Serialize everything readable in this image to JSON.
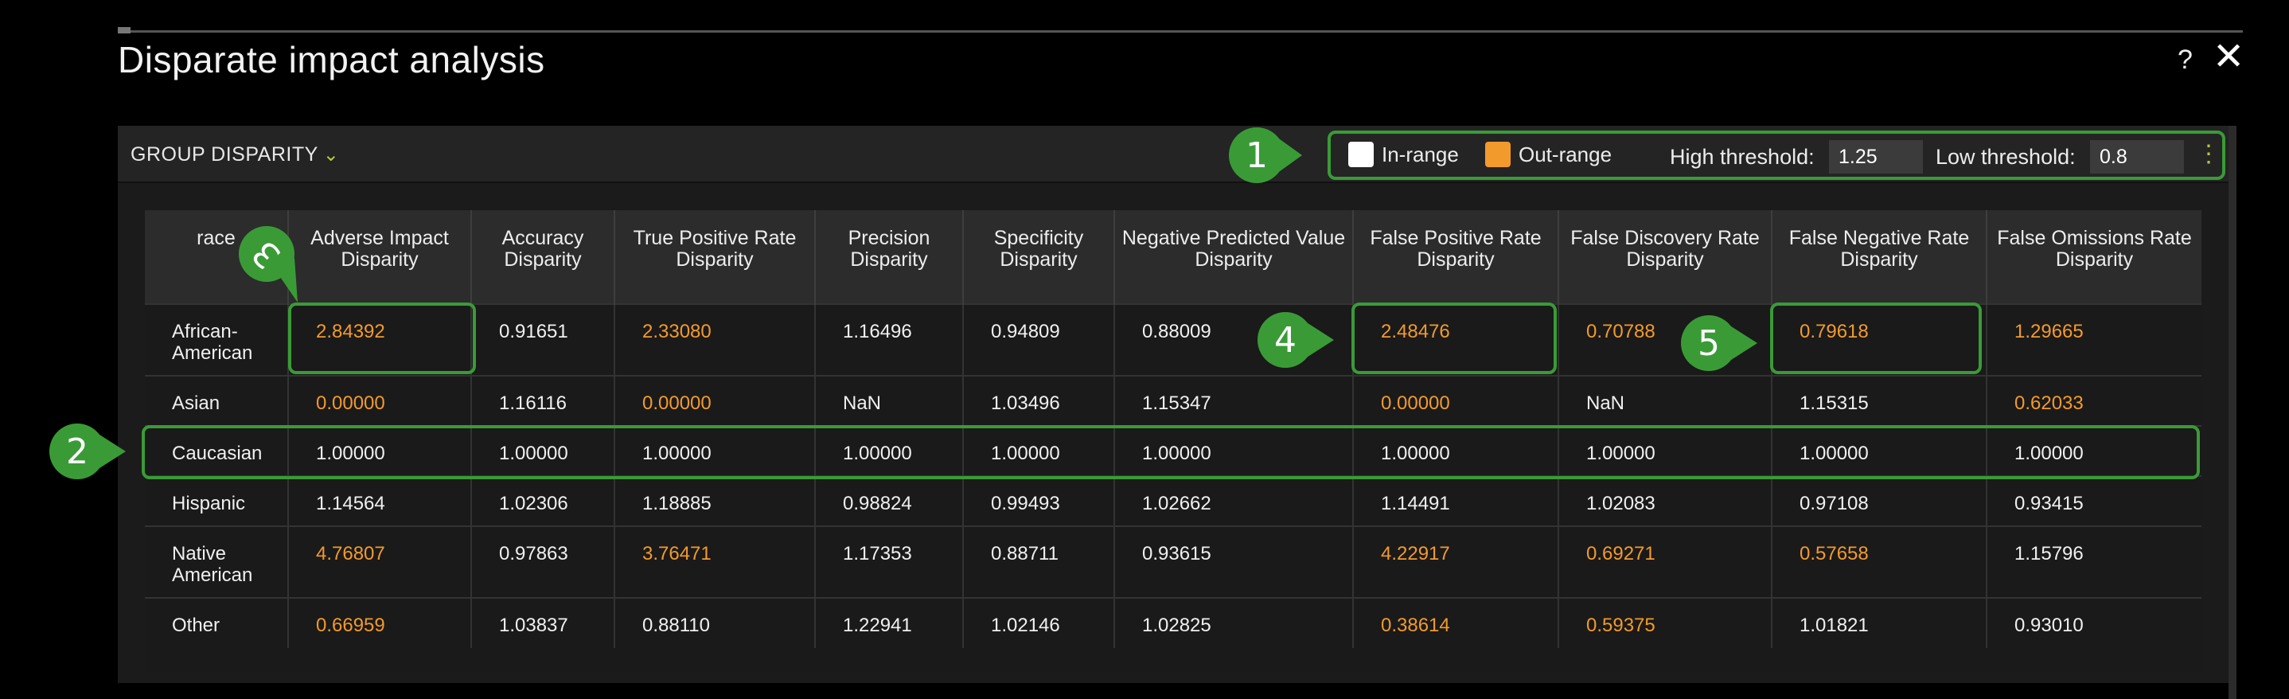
{
  "dialog": {
    "title": "Disparate impact analysis",
    "help_label": "?",
    "close_label": "✕"
  },
  "panel": {
    "section_title": "GROUP DISPARITY",
    "chevron": "⌄",
    "legend": {
      "in_range_label": "In-range",
      "out_range_label": "Out-range",
      "in_range_color": "#ffffff",
      "out_range_color": "#f39a2c"
    },
    "high_threshold_label": "High threshold:",
    "high_threshold_value": "1.25",
    "low_threshold_label": "Low threshold:",
    "low_threshold_value": "0.8",
    "menu_icon": "⋮"
  },
  "table": {
    "columns": [
      "race",
      "Adverse Impact Disparity",
      "Accuracy Disparity",
      "True Positive Rate Disparity",
      "Precision Disparity",
      "Specificity Disparity",
      "Negative Predicted Value Disparity",
      "False Positive Rate Disparity",
      "False Discovery Rate Disparity",
      "False Negative Rate Disparity",
      "False Omissions Rate Disparity"
    ],
    "rows": [
      {
        "label": "African-American",
        "cells": [
          "2.84392",
          "0.91651",
          "2.33080",
          "1.16496",
          "0.94809",
          "0.88009",
          "2.48476",
          "0.70788",
          "0.79618",
          "1.29665"
        ]
      },
      {
        "label": "Asian",
        "cells": [
          "0.00000",
          "1.16116",
          "0.00000",
          "NaN",
          "1.03496",
          "1.15347",
          "0.00000",
          "NaN",
          "1.15315",
          "0.62033"
        ]
      },
      {
        "label": "Caucasian",
        "cells": [
          "1.00000",
          "1.00000",
          "1.00000",
          "1.00000",
          "1.00000",
          "1.00000",
          "1.00000",
          "1.00000",
          "1.00000",
          "1.00000"
        ]
      },
      {
        "label": "Hispanic",
        "cells": [
          "1.14564",
          "1.02306",
          "1.18885",
          "0.98824",
          "0.99493",
          "1.02662",
          "1.14491",
          "1.02083",
          "0.97108",
          "0.93415"
        ]
      },
      {
        "label": "Native American",
        "cells": [
          "4.76807",
          "0.97863",
          "3.76471",
          "1.17353",
          "0.88711",
          "0.93615",
          "4.22917",
          "0.69271",
          "0.57658",
          "1.15796"
        ]
      },
      {
        "label": "Other",
        "cells": [
          "0.66959",
          "1.03837",
          "0.88110",
          "1.22941",
          "1.02146",
          "1.02825",
          "0.38614",
          "0.59375",
          "1.01821",
          "0.93010"
        ]
      }
    ]
  },
  "callouts": {
    "1": "1",
    "2": "2",
    "3": "3",
    "4": "4",
    "5": "5",
    "color": "#3a9b36"
  }
}
